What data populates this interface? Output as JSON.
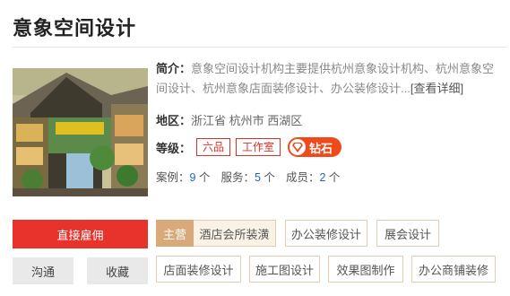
{
  "company": {
    "name": "意象空间设计"
  },
  "intro": {
    "label": "简介：",
    "text": "意象空间设计机构主要提供杭州意象设计机构、杭州意象空间设计、杭州意象店面装修设计、办公装修设计...",
    "more_link": "[查看详细]"
  },
  "region": {
    "label": "地区：",
    "value": "浙江省 杭州市 西湖区"
  },
  "level": {
    "label": "等级：",
    "tags": [
      "六品",
      "工作室"
    ],
    "diamond_label": "钻石",
    "diamond_color": "#f04a1a"
  },
  "stats": {
    "cases_label": "案例：",
    "cases_value": "9",
    "cases_unit": "个",
    "services_label": "服务：",
    "services_value": "5",
    "services_unit": "个",
    "members_label": "成员：",
    "members_value": "2",
    "members_unit": "个"
  },
  "buttons": {
    "hire": "直接雇佣",
    "chat": "沟通",
    "favorite": "收藏"
  },
  "services": {
    "main_label": "主营",
    "items": [
      "酒店会所装潢",
      "办公装修设计",
      "展会设计",
      "店面装修设计",
      "施工图设计",
      "效果图制作",
      "办公商铺装修"
    ]
  },
  "colors": {
    "accent_red": "#e8322c",
    "main_tag": "#d9a97a",
    "link_blue": "#1f66c4"
  }
}
